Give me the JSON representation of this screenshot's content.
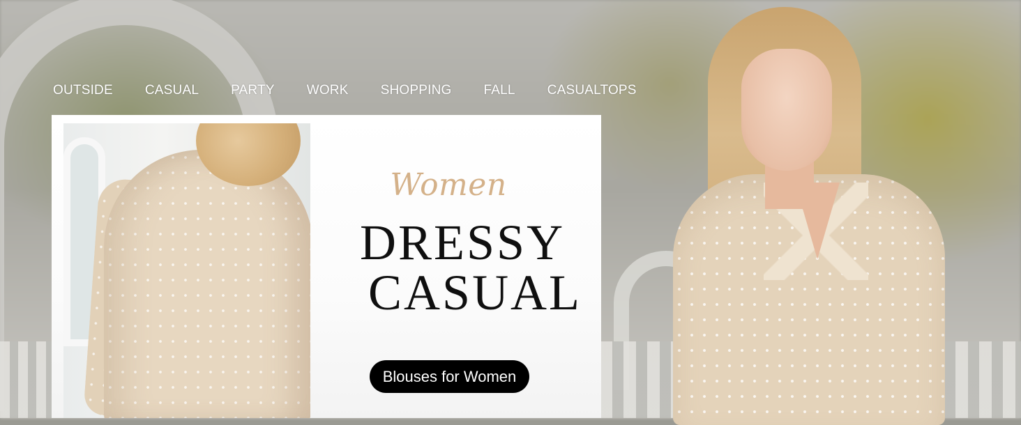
{
  "nav": {
    "items": [
      "OUTSIDE",
      "CASUAL",
      "PARTY",
      "WORK",
      "SHOPPING",
      "FALL",
      "CASUALTOPS"
    ]
  },
  "hero": {
    "eyebrow": "Women",
    "headline_line1": "DRESSY",
    "headline_line2": "CASUAL",
    "cta_label": "Blouses for Women"
  },
  "colors": {
    "accent_gold": "#d4b189",
    "cta_background": "#000000",
    "cta_text": "#ffffff",
    "headline": "#0f0f0f"
  }
}
